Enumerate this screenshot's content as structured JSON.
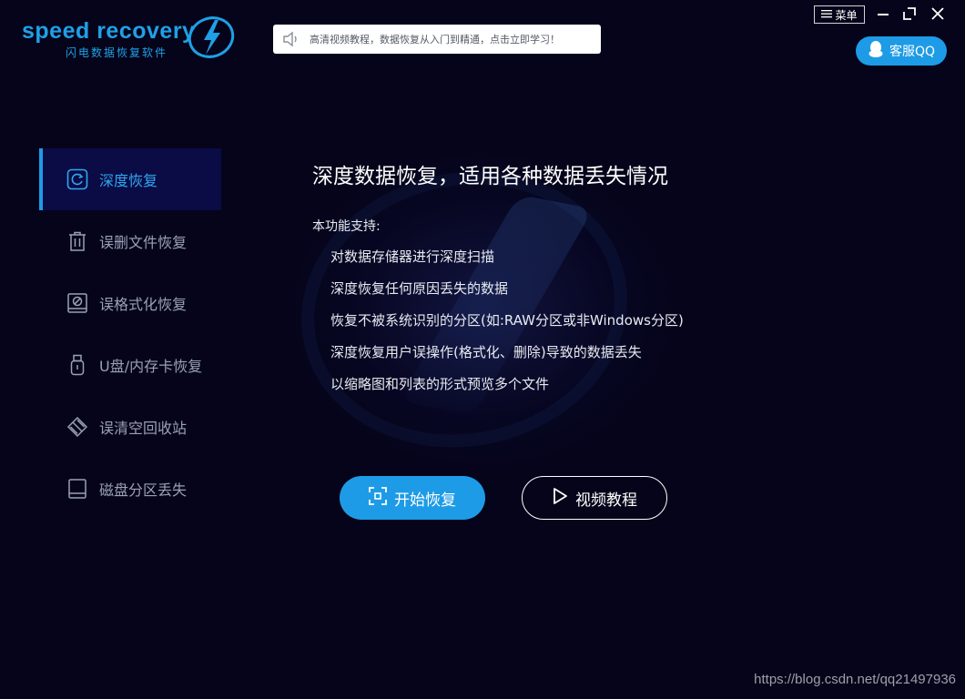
{
  "brand": {
    "name": "speed recovery",
    "subtitle": "闪电数据恢复软件",
    "icon": "lightning-bolt-icon",
    "color": "#1fa0e6"
  },
  "notice": {
    "icon": "speaker-icon",
    "text": "高清视频教程，数据恢复从入门到精通，点击立即学习！"
  },
  "window": {
    "menu_label": "菜单",
    "menu_icon": "menu-lines-icon",
    "controls": [
      "minimize-icon",
      "maximize-icon",
      "close-icon"
    ]
  },
  "support": {
    "label": "客服QQ",
    "icon": "qq-penguin-icon",
    "color": "#1e9be6"
  },
  "sidebar": {
    "items": [
      {
        "label": "深度恢复",
        "icon": "deep-recovery-icon",
        "active": true
      },
      {
        "label": "误删文件恢复",
        "icon": "trash-icon",
        "active": false
      },
      {
        "label": "误格式化恢复",
        "icon": "format-disk-icon",
        "active": false
      },
      {
        "label": "U盘/内存卡恢复",
        "icon": "usb-drive-icon",
        "active": false
      },
      {
        "label": "误清空回收站",
        "icon": "recycle-bin-icon",
        "active": false
      },
      {
        "label": "磁盘分区丢失",
        "icon": "disk-partition-icon",
        "active": false
      }
    ]
  },
  "main": {
    "title": "深度数据恢复，适用各种数据丢失情况",
    "support_label": "本功能支持:",
    "features": [
      "对数据存储器进行深度扫描",
      "深度恢复任何原因丢失的数据",
      "恢复不被系统识别的分区(如:RAW分区或非Windows分区)",
      "深度恢复用户误操作(格式化、删除)导致的数据丢失",
      "以缩略图和列表的形式预览多个文件"
    ],
    "start_button": "开始恢复",
    "start_icon": "scan-icon",
    "video_button": "视频教程",
    "video_icon": "play-icon"
  },
  "watermark": "https://blog.csdn.net/qq21497936"
}
